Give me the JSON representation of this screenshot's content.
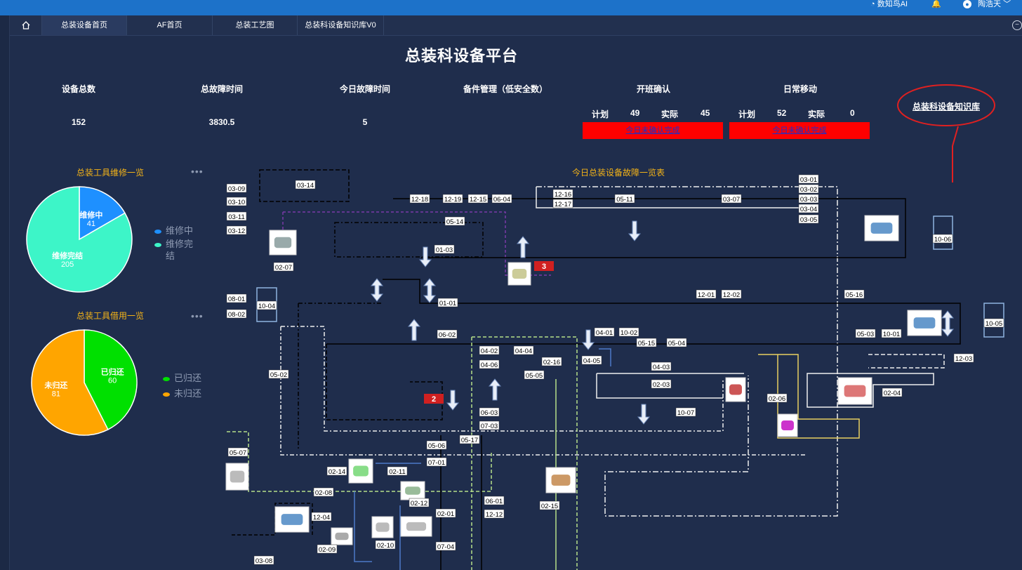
{
  "topbar": {
    "ai_label": "数知鸟AI",
    "user_name": "陶浩天"
  },
  "tabs": [
    {
      "label": "总装设备首页"
    },
    {
      "label": "AF首页"
    },
    {
      "label": "总装工艺图"
    },
    {
      "label": "总装科设备知识库V0"
    }
  ],
  "page_title": "总装科设备平台",
  "stats": {
    "total_devices": {
      "label": "设备总数",
      "value": "152"
    },
    "total_fault_time": {
      "label": "总故障时间",
      "value": "3830.5"
    },
    "today_fault_time": {
      "label": "今日故障时间",
      "value": "5"
    },
    "spare_parts": {
      "label": "备件管理（低安全数）"
    },
    "shift_confirm": {
      "label": "开班确认",
      "plan_label": "计划",
      "plan": "49",
      "actual_label": "实际",
      "actual": "45",
      "button": "今日未确认完成"
    },
    "daily_move": {
      "label": "日常移动",
      "plan_label": "计划",
      "plan": "52",
      "actual_label": "实际",
      "actual": "0",
      "button": "今日未确认完成"
    }
  },
  "knowledge_link": "总装科设备知识库",
  "repair_panel": {
    "title": "总装工具维修一览",
    "more": "•••",
    "slices": [
      {
        "name": "维修中",
        "value": 41,
        "color": "#1e90ff"
      },
      {
        "name": "维修完结",
        "value": 205,
        "color": "#3df5c8"
      }
    ],
    "legend": [
      {
        "label": "维修中",
        "color": "#1e90ff"
      },
      {
        "label": "维修完\n结",
        "color": "#3df5c8"
      }
    ]
  },
  "borrow_panel": {
    "title": "总装工具借用一览",
    "more": "•••",
    "slices": [
      {
        "name": "已归还",
        "value": 60,
        "color": "#00e000"
      },
      {
        "name": "未归还",
        "value": 81,
        "color": "#ffa500"
      }
    ],
    "legend": [
      {
        "label": "已归还",
        "color": "#00e000"
      },
      {
        "label": "未归还",
        "color": "#ffa500"
      }
    ]
  },
  "fault_table_title": "今日总装设备故障一览表",
  "alarms": [
    {
      "text": "3"
    },
    {
      "text": "2"
    }
  ],
  "station_labels": [
    "03-14",
    "03-09",
    "03-10",
    "03-11",
    "03-12",
    "12-18",
    "12-19",
    "12-15",
    "06-04",
    "12-16",
    "12-17",
    "05-11",
    "03-07",
    "03-01",
    "03-02",
    "03-03",
    "03-04",
    "03-05",
    "05-14",
    "01-03",
    "02-07",
    "08-01",
    "10-04",
    "08-02",
    "01-01",
    "12-01",
    "12-02",
    "05-16",
    "06-02",
    "04-01",
    "10-02",
    "05-15",
    "05-04",
    "05-03",
    "10-01",
    "05-02",
    "04-02",
    "04-04",
    "02-16",
    "04-05",
    "04-06",
    "05-05",
    "04-03",
    "02-03",
    "02-06",
    "02-04",
    "12-03",
    "10-07",
    "06-03",
    "07-03",
    "05-17",
    "05-06",
    "07-01",
    "05-07",
    "02-14",
    "02-11",
    "02-08",
    "02-12",
    "06-01",
    "12-12",
    "02-15",
    "12-04",
    "02-01",
    "02-09",
    "02-10",
    "07-04",
    "03-08",
    "10-06",
    "10-05"
  ]
}
